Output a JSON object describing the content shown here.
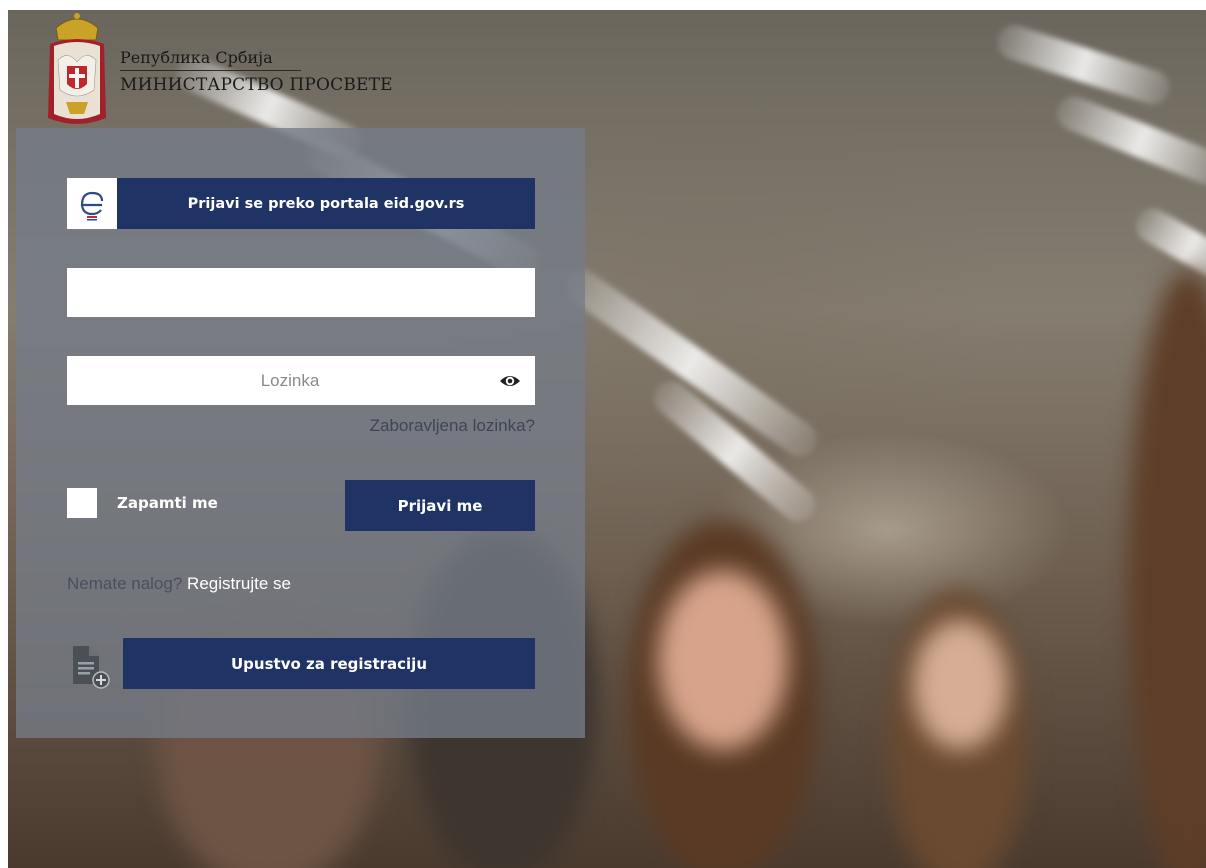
{
  "header": {
    "line1": "Република Србија",
    "line2": "МИНИСТАРСТВО ПРОСВЕТЕ",
    "crest_icon": "serbian-coat-of-arms"
  },
  "login": {
    "eid_button_label": "Prijavi se preko portala eid.gov.rs",
    "eid_icon": "eid-logo-icon",
    "username_value": "",
    "password_placeholder": "Lozinka",
    "password_toggle_icon": "eye-icon",
    "forgot_password": "Zaboravljena lozinka?",
    "remember_label": "Zapamti me",
    "remember_checked": false,
    "login_button_label": "Prijavi me",
    "no_account_text": "Nemate nalog?",
    "register_link": "Registrujte se",
    "guide_icon": "document-add-icon",
    "guide_button_label": "Upustvo za registraciju"
  },
  "colors": {
    "button": "#1f3464",
    "panel": "rgba(116,124,136,0.78)"
  }
}
